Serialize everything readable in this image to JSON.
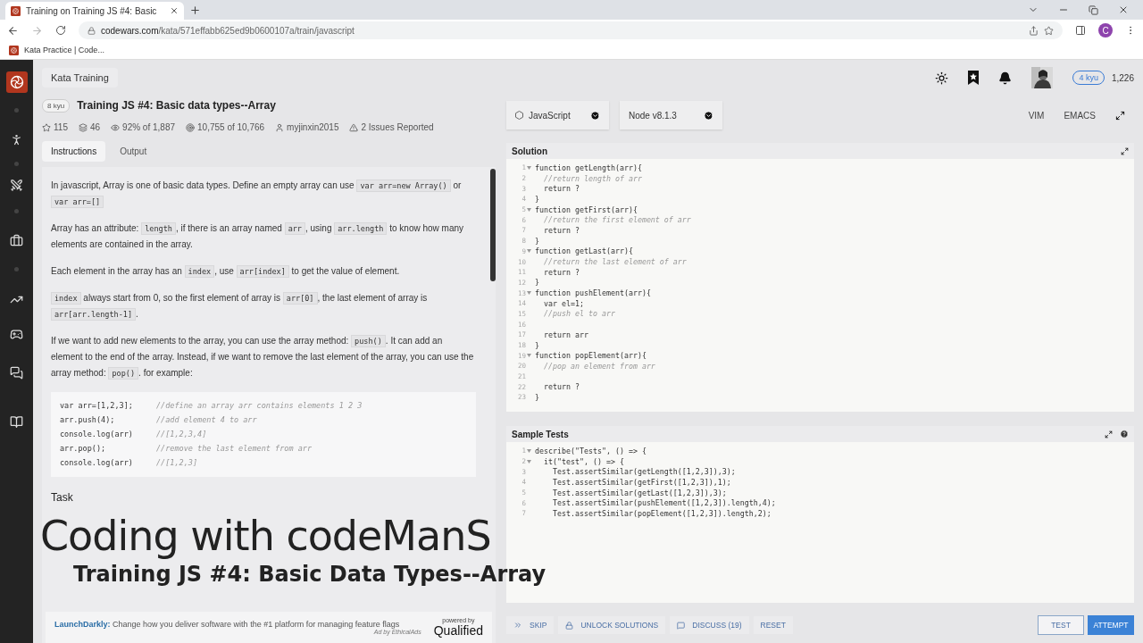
{
  "browser": {
    "tab_title": "Training on Training JS #4: Basic",
    "url_host": "codewars.com",
    "url_path": "/kata/571effabb625ed9b0600107a/train/javascript",
    "bookmark": "Kata Practice | Code...",
    "avatar_letter": "C"
  },
  "header": {
    "section": "Kata Training",
    "rank": "4 kyu",
    "honor": "1,226"
  },
  "kata": {
    "rank": "8 kyu",
    "title": "Training JS #4: Basic data types--Array",
    "stats": [
      {
        "kind": "stars",
        "text": "115"
      },
      {
        "kind": "collections",
        "text": "46"
      },
      {
        "kind": "satisfaction",
        "text": "92% of 1,887"
      },
      {
        "kind": "completions",
        "text": "10,755 of 10,766"
      },
      {
        "kind": "author",
        "text": "myjinxin2015"
      },
      {
        "kind": "issues",
        "text": "2 Issues Reported"
      }
    ]
  },
  "tabs": [
    {
      "label": "Instructions",
      "selected": true
    },
    {
      "label": "Output",
      "selected": false
    }
  ],
  "instructions": {
    "paragraphs": [
      [
        {
          "kind": "text",
          "text": "In javascript, Array is one of basic data types. Define an empty array can use "
        },
        {
          "kind": "code",
          "text": "var arr=new Array()"
        },
        {
          "kind": "text",
          "text": " or "
        },
        {
          "kind": "code",
          "text": "var arr=[]"
        }
      ],
      [
        {
          "kind": "text",
          "text": "Array has an attribute: "
        },
        {
          "kind": "code",
          "text": "length"
        },
        {
          "kind": "text",
          "text": ", if there is an array named "
        },
        {
          "kind": "code",
          "text": "arr"
        },
        {
          "kind": "text",
          "text": ", using "
        },
        {
          "kind": "code",
          "text": "arr.length"
        },
        {
          "kind": "text",
          "text": " to know how many elements are contained in the array."
        }
      ],
      [
        {
          "kind": "text",
          "text": "Each element in the array has an "
        },
        {
          "kind": "code",
          "text": "index"
        },
        {
          "kind": "text",
          "text": ", use "
        },
        {
          "kind": "code",
          "text": "arr[index]"
        },
        {
          "kind": "text",
          "text": " to get the value of element."
        }
      ],
      [
        {
          "kind": "code",
          "text": "index"
        },
        {
          "kind": "text",
          "text": " always start from 0, so the first element of array is "
        },
        {
          "kind": "code",
          "text": "arr[0]"
        },
        {
          "kind": "text",
          "text": ", the last element of array is "
        },
        {
          "kind": "code",
          "text": "arr[arr.length-1]"
        },
        {
          "kind": "text",
          "text": "."
        }
      ],
      [
        {
          "kind": "text",
          "text": "If we want to add new elements to the array, you can use the array method: "
        },
        {
          "kind": "code",
          "text": "push()"
        },
        {
          "kind": "text",
          "text": ". It can add an element to the end of the array. Instead, if we want to remove the last element of the array, you can use the array method: "
        },
        {
          "kind": "code",
          "text": "pop()"
        },
        {
          "kind": "text",
          "text": ". for example:"
        }
      ]
    ],
    "example": [
      {
        "code": "var arr=[1,2,3];",
        "comment": "//define an array arr contains elements 1 2 3"
      },
      {
        "code": "arr.push(4);",
        "comment": "//add element 4 to arr"
      },
      {
        "code": "console.log(arr)",
        "comment": "//[1,2,3,4]"
      },
      {
        "code": "arr.pop();",
        "comment": "//remove the last element from arr"
      },
      {
        "code": "console.log(arr)",
        "comment": "//[1,2,3]"
      }
    ],
    "task_heading": "Task"
  },
  "ad": {
    "brand": "LaunchDarkly:",
    "text": "Change how you deliver software with the #1 platform for managing feature flags",
    "note": "Ad by EthicalAds",
    "powered_by": "powered by",
    "logo": "Qualified"
  },
  "editor": {
    "language": "JavaScript",
    "version": "Node v8.1.3",
    "modes": [
      "VIM",
      "EMACS"
    ]
  },
  "solution": {
    "title": "Solution",
    "lines": [
      {
        "num": "1",
        "text": "function getLength(arr){",
        "kind": "code",
        "fold": true
      },
      {
        "num": "2",
        "text": "  //return length of arr",
        "kind": "comment",
        "fold": false
      },
      {
        "num": "3",
        "text": "  return ?",
        "kind": "code",
        "fold": false
      },
      {
        "num": "4",
        "text": "}",
        "kind": "code",
        "fold": false
      },
      {
        "num": "5",
        "text": "function getFirst(arr){",
        "kind": "code",
        "fold": true
      },
      {
        "num": "6",
        "text": "  //return the first element of arr",
        "kind": "comment",
        "fold": false
      },
      {
        "num": "7",
        "text": "  return ?",
        "kind": "code",
        "fold": false
      },
      {
        "num": "8",
        "text": "}",
        "kind": "code",
        "fold": false
      },
      {
        "num": "9",
        "text": "function getLast(arr){",
        "kind": "code",
        "fold": true
      },
      {
        "num": "10",
        "text": "  //return the last element of arr",
        "kind": "comment",
        "fold": false
      },
      {
        "num": "11",
        "text": "  return ?",
        "kind": "code",
        "fold": false
      },
      {
        "num": "12",
        "text": "}",
        "kind": "code",
        "fold": false
      },
      {
        "num": "13",
        "text": "function pushElement(arr){",
        "kind": "code",
        "fold": true
      },
      {
        "num": "14",
        "text": "  var el=1;",
        "kind": "code",
        "fold": false
      },
      {
        "num": "15",
        "text": "  //push el to arr",
        "kind": "comment",
        "fold": false
      },
      {
        "num": "16",
        "fold": false
      },
      {
        "num": "17",
        "text": "  return arr",
        "kind": "code",
        "fold": false
      },
      {
        "num": "18",
        "text": "}",
        "kind": "code",
        "fold": false
      },
      {
        "num": "19",
        "text": "function popElement(arr){",
        "kind": "code",
        "fold": true
      },
      {
        "num": "20",
        "text": "  //pop an element from arr",
        "kind": "comment",
        "fold": false
      },
      {
        "num": "21",
        "fold": false
      },
      {
        "num": "22",
        "text": "  return ?",
        "kind": "code",
        "fold": false
      },
      {
        "num": "23",
        "text": "}",
        "kind": "code",
        "fold": false
      }
    ]
  },
  "tests": {
    "title": "Sample Tests",
    "lines": [
      {
        "num": "1",
        "text": "describe(\"Tests\", () => {",
        "kind": "code",
        "fold": true
      },
      {
        "num": "2",
        "text": "  it(\"test\", () => {",
        "kind": "code",
        "fold": true
      },
      {
        "num": "3",
        "text": "    Test.assertSimilar(getLength([1,2,3]),3);",
        "kind": "code",
        "fold": false
      },
      {
        "num": "4",
        "text": "    Test.assertSimilar(getFirst([1,2,3]),1);",
        "kind": "code",
        "fold": false
      },
      {
        "num": "5",
        "text": "    Test.assertSimilar(getLast([1,2,3]),3);",
        "kind": "code",
        "fold": false
      },
      {
        "num": "6",
        "text": "    Test.assertSimilar(pushElement([1,2,3]).length,4);",
        "kind": "code",
        "fold": false
      },
      {
        "num": "7",
        "text": "    Test.assertSimilar(popElement([1,2,3]).length,2);",
        "kind": "code",
        "fold": false
      }
    ]
  },
  "buttons": [
    {
      "label": "SKIP",
      "kind": "skip"
    },
    {
      "label": "UNLOCK SOLUTIONS",
      "kind": "unlock"
    },
    {
      "label": "DISCUSS (19)",
      "kind": "discuss"
    },
    {
      "label": "RESET",
      "kind": "reset"
    }
  ],
  "actions": [
    {
      "label": "TEST",
      "primary": false
    },
    {
      "label": "ATTEMPT",
      "primary": true
    }
  ],
  "overlay": {
    "title": "Coding with codeManS",
    "subtitle": "Training JS #4: Basic Data Types--Array"
  }
}
